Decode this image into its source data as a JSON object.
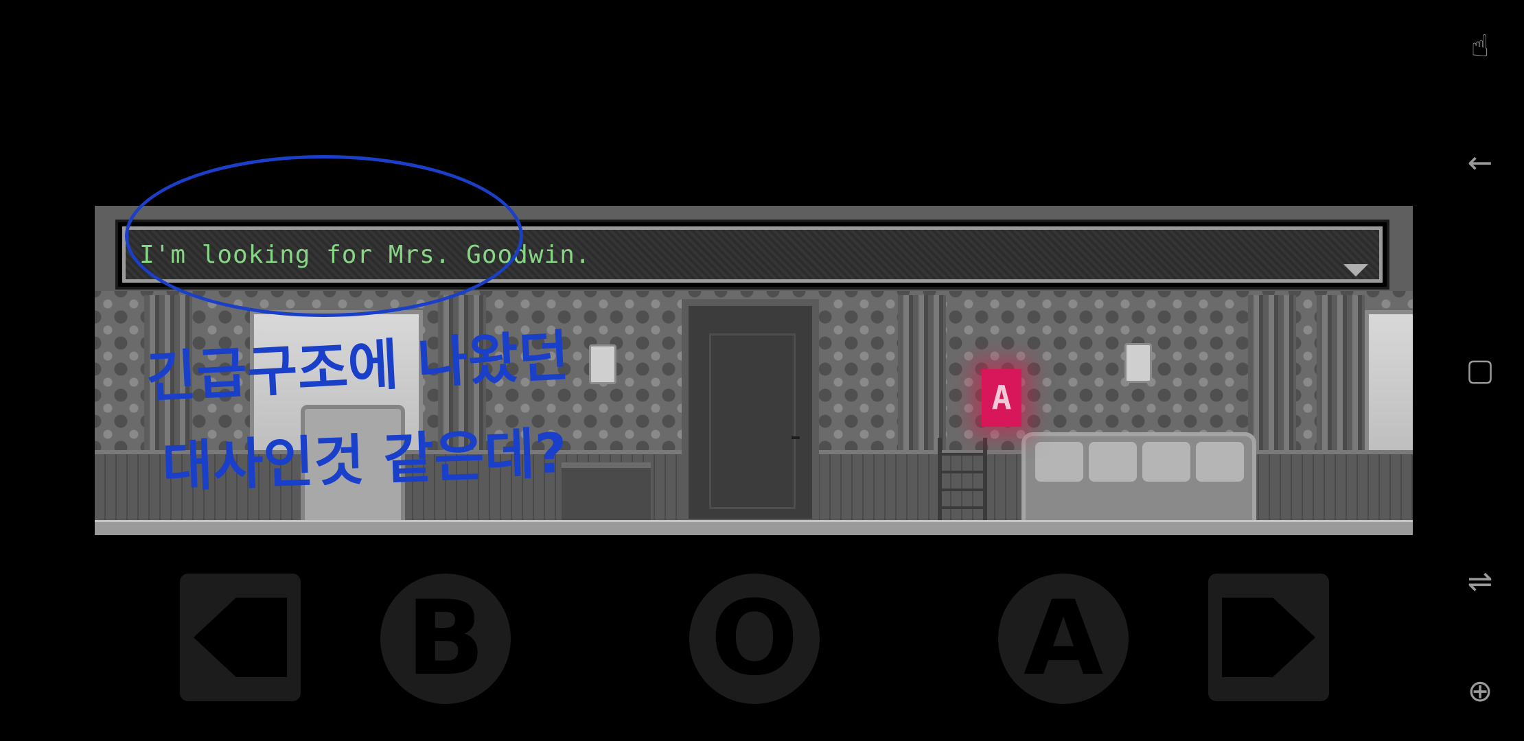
{
  "dialog": {
    "text": "I'm looking for Mrs. Goodwin."
  },
  "scene": {
    "sign_letter": "A"
  },
  "annotation": {
    "color": "#1a3fc8",
    "line1": "긴급구조에 나왔던",
    "line2": "대사인것 같은데?"
  },
  "controls": {
    "b_label": "B",
    "o_label": "O",
    "a_label": "A",
    "left_icon": "left-arrow-icon",
    "right_icon": "right-arrow-icon"
  },
  "sidebar": {
    "icons": [
      "touch-gesture-icon",
      "back-icon",
      "recent-apps-icon",
      "split-screen-icon",
      "gamepad-icon"
    ],
    "glyphs": [
      "☝",
      "←",
      "▢",
      "⇌",
      "⊕"
    ]
  }
}
